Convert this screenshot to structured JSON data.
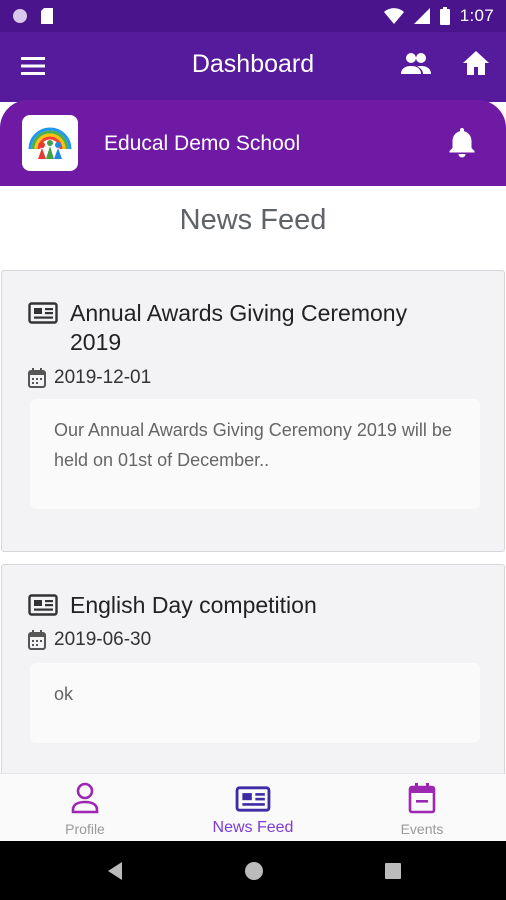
{
  "status_bar": {
    "time": "1:07",
    "icons": [
      "circle-indicator-icon",
      "sd-card-icon",
      "wifi-icon",
      "signal-icon",
      "battery-icon"
    ]
  },
  "app_bar": {
    "title": "Dashboard",
    "icons": [
      "menu-icon",
      "people-icon",
      "home-icon"
    ]
  },
  "school": {
    "name": "Educal Demo School",
    "icons": [
      "school-logo",
      "bell-icon"
    ]
  },
  "page": {
    "title": "News Feed"
  },
  "news": [
    {
      "title": "Annual Awards Giving Ceremony 2019",
      "date": "2019-12-01",
      "body": "Our Annual Awards Giving Ceremony 2019 will be held on 01st of December.."
    },
    {
      "title": "English Day competition",
      "date": "2019-06-30",
      "body": "ok"
    }
  ],
  "bottom_nav": [
    {
      "label": "Profile",
      "icon": "person-icon",
      "active": false
    },
    {
      "label": "News Feed",
      "icon": "newspaper-icon",
      "active": true
    },
    {
      "label": "Events",
      "icon": "calendar-icon",
      "active": false
    }
  ],
  "colors": {
    "status_bar": "#4a148c",
    "app_bar": "#561a9c",
    "school_header": "#6f1aa5",
    "accent_purple": "#9c27b0",
    "news_feed_active": "#3f2aa6"
  }
}
